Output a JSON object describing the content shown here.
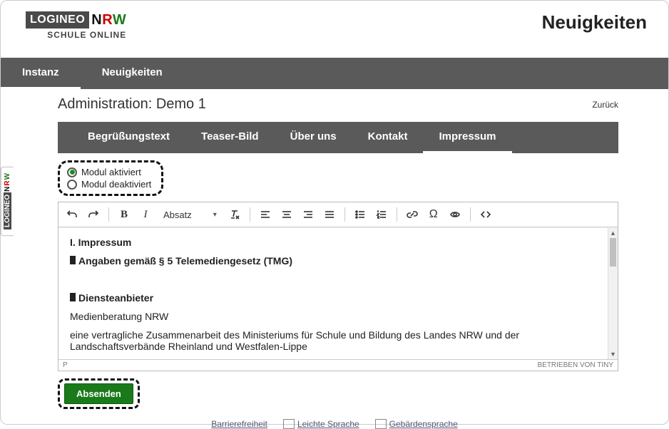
{
  "logo": {
    "left": "LOGINEO",
    "nrw_n": "N",
    "nrw_r": "R",
    "nrw_w": "W",
    "sub": "SCHULE ONLINE"
  },
  "header": {
    "page_title": "Neuigkeiten"
  },
  "main_nav": {
    "instanz": "Instanz",
    "neuigkeiten": "Neuigkeiten"
  },
  "subheader": {
    "title": "Administration: Demo 1",
    "back": "Zurück"
  },
  "subtabs": {
    "begruessung": "Begrüßungstext",
    "teaser": "Teaser-Bild",
    "ueber": "Über uns",
    "kontakt": "Kontakt",
    "impressum": "Impressum"
  },
  "module_radio": {
    "activated": "Modul aktiviert",
    "deactivated": "Modul deaktiviert",
    "selected": "activated"
  },
  "toolbar": {
    "format_label": "Absatz"
  },
  "editor": {
    "h1": "I. Impressum",
    "line1": "Angaben gemäß § 5 Telemediengesetz (TMG)",
    "line2": "Diensteanbieter",
    "p1": "Medienberatung NRW",
    "p2": "eine vertragliche Zusammenarbeit des Ministeriums für Schule und Bildung des Landes NRW und der Landschaftsverbände Rheinland und Westfalen-Lippe",
    "status_path": "P",
    "powered": "BETRIEBEN VON TINY"
  },
  "submit": {
    "label": "Absenden"
  },
  "footer": {
    "a11y": "Barrierefreiheit",
    "leichte": "Leichte Sprache",
    "gebaerden": "Gebärdensprache"
  },
  "side_badge": {
    "left": "LOGINEO"
  }
}
